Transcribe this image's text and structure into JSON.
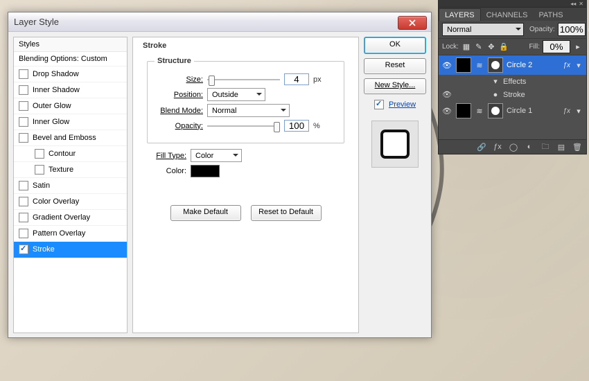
{
  "dialog": {
    "title": "Layer Style",
    "styles_header": "Styles",
    "blending_row_label": "Blending Options: Custom",
    "effects": [
      {
        "label": "Drop Shadow",
        "checked": false
      },
      {
        "label": "Inner Shadow",
        "checked": false
      },
      {
        "label": "Outer Glow",
        "checked": false
      },
      {
        "label": "Inner Glow",
        "checked": false
      },
      {
        "label": "Bevel and Emboss",
        "checked": false
      },
      {
        "label": "Contour",
        "checked": false,
        "indent": true
      },
      {
        "label": "Texture",
        "checked": false,
        "indent": true
      },
      {
        "label": "Satin",
        "checked": false
      },
      {
        "label": "Color Overlay",
        "checked": false
      },
      {
        "label": "Gradient Overlay",
        "checked": false
      },
      {
        "label": "Pattern Overlay",
        "checked": false
      },
      {
        "label": "Stroke",
        "checked": true,
        "selected": true
      }
    ],
    "main_legend": "Stroke",
    "structure_legend": "Structure",
    "fields": {
      "size_label": "Size:",
      "size_value": "4",
      "size_unit": "px",
      "position_label": "Position:",
      "position_value": "Outside",
      "blend_label": "Blend Mode:",
      "blend_value": "Normal",
      "opacity_label": "Opacity:",
      "opacity_value": "100",
      "opacity_unit": "%",
      "filltype_label": "Fill Type:",
      "filltype_value": "Color",
      "color_label": "Color:",
      "color_value": "#000000"
    },
    "buttons": {
      "make_default": "Make Default",
      "reset_default": "Reset to Default",
      "ok": "OK",
      "reset": "Reset",
      "new_style": "New Style...",
      "preview_label": "Preview"
    }
  },
  "panel": {
    "tabs": [
      "LAYERS",
      "CHANNELS",
      "PATHS"
    ],
    "active_tab": 0,
    "blend_mode": "Normal",
    "opacity_label": "Opacity:",
    "opacity_value": "100%",
    "lock_label": "Lock:",
    "fill_label": "Fill:",
    "fill_value": "0%",
    "layers": [
      {
        "name": "Circle 2",
        "selected": true,
        "fx": true,
        "sub": [
          {
            "name": "Effects"
          },
          {
            "name": "Stroke",
            "eye": true
          }
        ]
      },
      {
        "name": "Circle 1",
        "selected": false,
        "fx": true
      }
    ]
  }
}
